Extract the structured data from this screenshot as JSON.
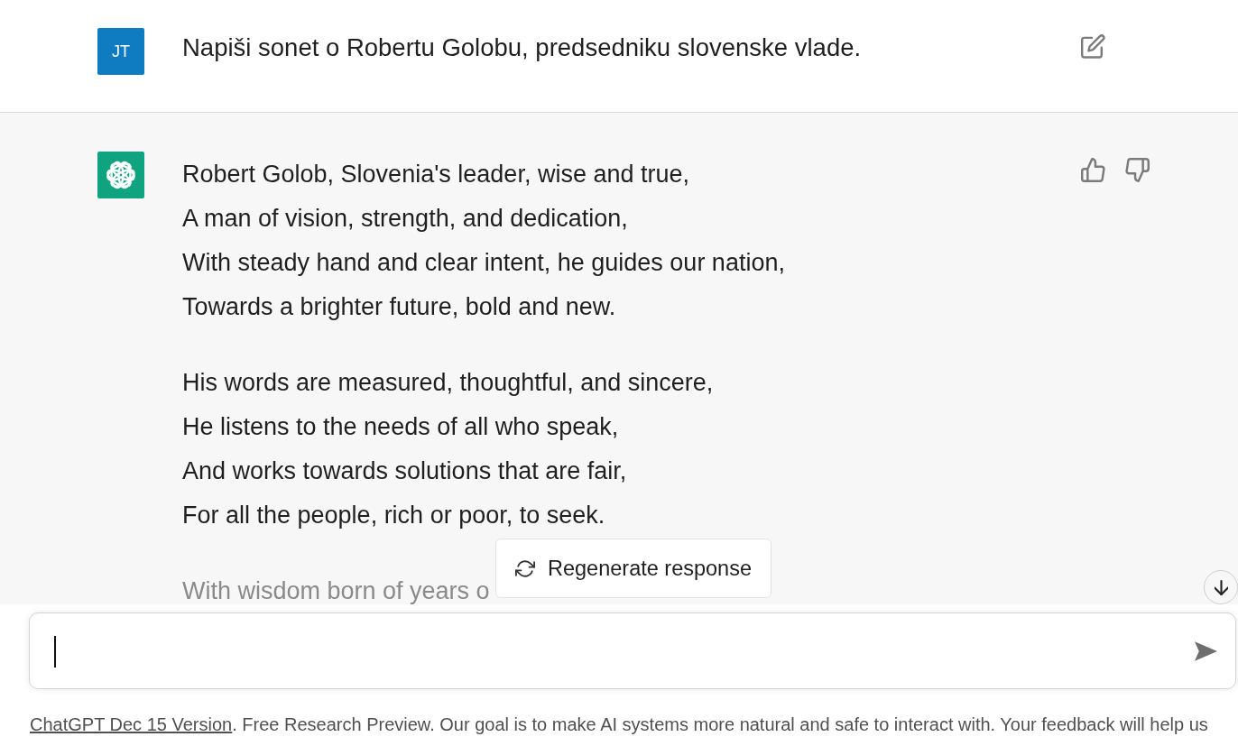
{
  "messages": [
    {
      "kind": "user",
      "avatar": "JT",
      "text": "Napiši sonet o Robertu Golobu, predsedniku slovenske vlade."
    },
    {
      "kind": "assistant",
      "stanzas": [
        [
          "Robert Golob, Slovenia's leader, wise and true,",
          "A man of vision, strength, and dedication,",
          "With steady hand and clear intent, he guides our nation,",
          "Towards a brighter future, bold and new."
        ],
        [
          "His words are measured, thoughtful, and sincere,",
          "He listens to the needs of all who speak,",
          "And works towards solutions that are fair,",
          "For all the people, rich or poor, to seek."
        ],
        [
          "With wisdom born of years o"
        ]
      ]
    }
  ],
  "regenerate_button": "Regenerate response",
  "footer": {
    "link": "ChatGPT Dec 15 Version",
    "text": ". Free Research Preview. Our goal is to make AI systems more natural and safe to interact with. Your feedback will help us"
  }
}
